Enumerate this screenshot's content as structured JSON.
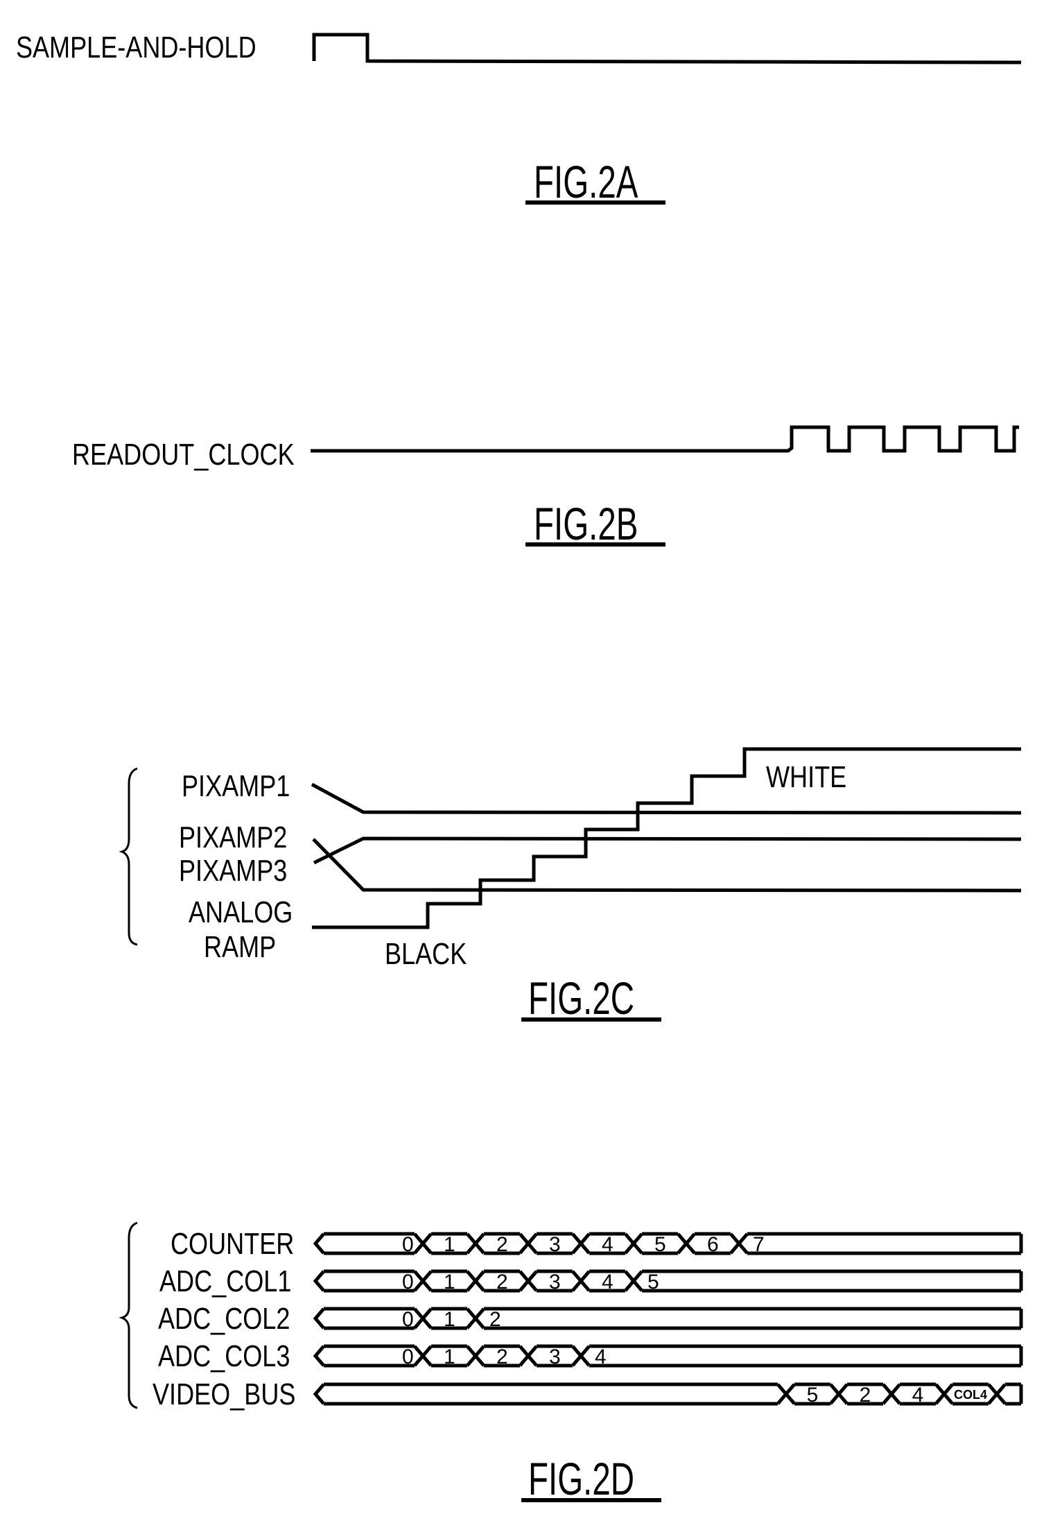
{
  "figures": {
    "fig2a": {
      "caption": "FIG.2A",
      "signal": {
        "name": "SAMPLE-AND-HOLD",
        "waveform": "single pulse high at start, then low"
      }
    },
    "fig2b": {
      "caption": "FIG.2B",
      "signal": {
        "name": "READOUT_CLOCK",
        "waveform": "low, then clock pulses",
        "pulse_count": 5
      }
    },
    "fig2c": {
      "caption": "FIG.2C",
      "signals": [
        {
          "name": "PIXAMP1"
        },
        {
          "name": "PIXAMP2"
        },
        {
          "name": "PIXAMP3"
        },
        {
          "name_line1": "ANALOG",
          "name_line2": "RAMP"
        }
      ],
      "labels": {
        "black": "BLACK",
        "white": "WHITE"
      },
      "ramp_steps": 7
    },
    "fig2d": {
      "caption": "FIG.2D",
      "buses": [
        {
          "name": "COUNTER",
          "values": [
            "0",
            "1",
            "2",
            "3",
            "4",
            "5",
            "6",
            "7"
          ]
        },
        {
          "name": "ADC_COL1",
          "values": [
            "0",
            "1",
            "2",
            "3",
            "4",
            "5"
          ]
        },
        {
          "name": "ADC_COL2",
          "values": [
            "0",
            "1",
            "2"
          ]
        },
        {
          "name": "ADC_COL3",
          "values": [
            "0",
            "1",
            "2",
            "3",
            "4"
          ]
        },
        {
          "name": "VIDEO_BUS",
          "values": [
            "",
            "5",
            "2",
            "4",
            "COL4"
          ]
        }
      ]
    }
  }
}
